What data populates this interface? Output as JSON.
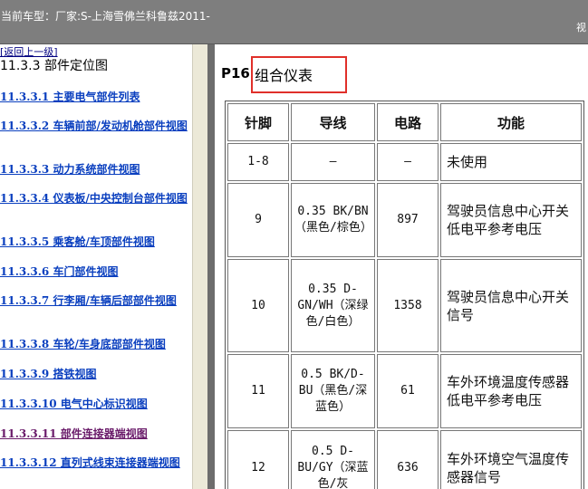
{
  "titlebar": {
    "title": "当前车型：厂家:S-上海雪佛兰科鲁兹2011-",
    "right_text": "视"
  },
  "nav": {
    "back_label": "[返回上一级]",
    "section_title": "11.3.3 部件定位图",
    "items": [
      {
        "label": "11.3.3.1 主要电气部件列表"
      },
      {
        "label": "11.3.3.2 车辆前部/发动机舱部件视图"
      },
      {
        "label": "11.3.3.3 动力系统部件视图"
      },
      {
        "label": "11.3.3.4 仪表板/中央控制台部件视图"
      },
      {
        "label": "11.3.3.5 乘客舱/车顶部件视图"
      },
      {
        "label": "11.3.3.6 车门部件视图"
      },
      {
        "label": "11.3.3.7 行李厢/车辆后部部件视图"
      },
      {
        "label": "11.3.3.8 车轮/车身底部部件视图"
      },
      {
        "label": "11.3.3.9 搭铁视图"
      },
      {
        "label": "11.3.3.10 电气中心标识视图"
      },
      {
        "label": "11.3.3.11 部件连接器端视图"
      },
      {
        "label": "11.3.3.12 直列式线束连接器端视图"
      }
    ]
  },
  "content": {
    "part_label": "P16",
    "part_name": "组合仪表",
    "highlight_color": "#e0302a",
    "table": {
      "headers": [
        "针脚",
        "导线",
        "电路",
        "功能"
      ],
      "rows": [
        {
          "pin": "1-8",
          "wire": "—",
          "circuit": "—",
          "func": "未使用"
        },
        {
          "pin": "9",
          "wire": "0.35 BK/BN（黑色/棕色）",
          "circuit": "897",
          "func": "驾驶员信息中心开关低电平参考电压"
        },
        {
          "pin": "10",
          "wire": "0.35 D-GN/WH（深绿色/白色）",
          "circuit": "1358",
          "func": "驾驶员信息中心开关信号"
        },
        {
          "pin": "11",
          "wire": "0.5 BK/D-BU（黑色/深蓝色）",
          "circuit": "61",
          "func": "车外环境温度传感器低电平参考电压"
        },
        {
          "pin": "12",
          "wire": "0.5 D-BU/GY（深蓝色/灰",
          "circuit": "636",
          "func": "车外环境空气温度传感器信号"
        }
      ]
    }
  }
}
